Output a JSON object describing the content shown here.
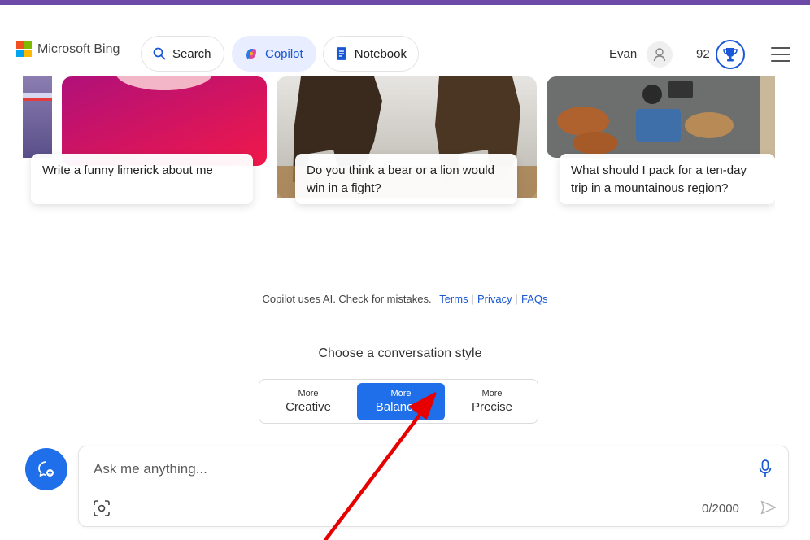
{
  "header": {
    "brand": "Microsoft Bing",
    "nav": [
      {
        "label": "Search",
        "icon": "search-icon"
      },
      {
        "label": "Copilot",
        "icon": "copilot-icon"
      },
      {
        "label": "Notebook",
        "icon": "notebook-icon"
      }
    ],
    "user_name": "Evan",
    "rewards_points": "92"
  },
  "suggestions": [
    {
      "text": "Write a funny limerick about me"
    },
    {
      "text": "Do you think a bear or a lion would win in a fight?"
    },
    {
      "text": "What should I pack for a ten-day trip in a mountainous region?"
    }
  ],
  "disclaimer": {
    "text": "Copilot uses AI. Check for mistakes.",
    "links": [
      "Terms",
      "Privacy",
      "FAQs"
    ]
  },
  "conversation_style": {
    "title": "Choose a conversation style",
    "options": [
      {
        "small": "More",
        "label": "Creative"
      },
      {
        "small": "More",
        "label": "Balanced"
      },
      {
        "small": "More",
        "label": "Precise"
      }
    ],
    "selected": "Balanced"
  },
  "chat": {
    "placeholder": "Ask me anything...",
    "counter": "0/2000"
  },
  "colors": {
    "accent": "#1f6fea",
    "top_bar": "#6d4aa8",
    "annotation_arrow": "#e60000"
  }
}
